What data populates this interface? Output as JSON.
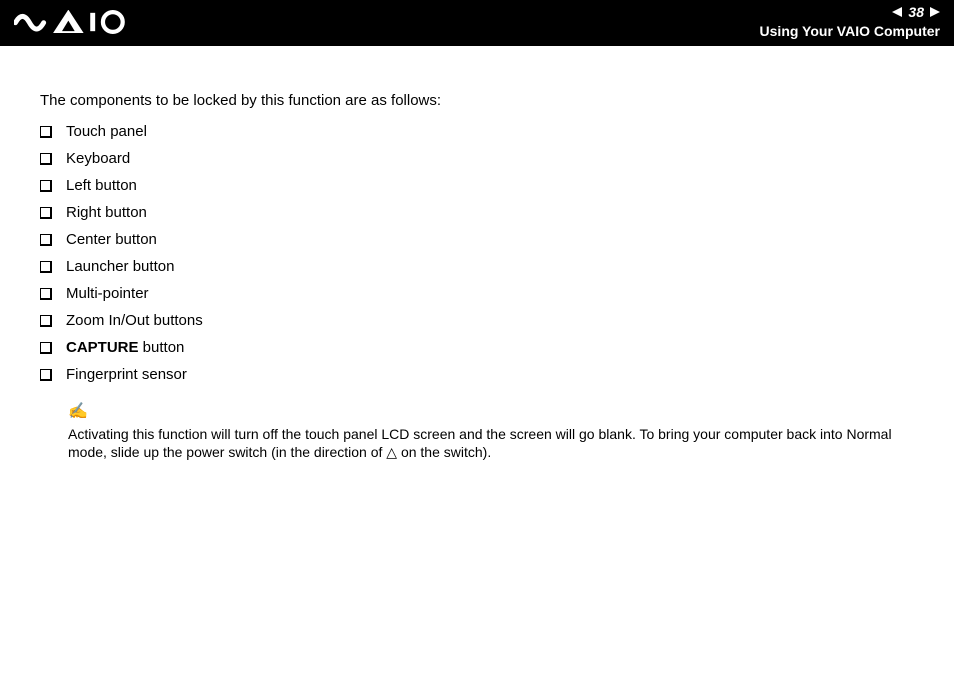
{
  "header": {
    "page_number": "38",
    "section_title": "Using Your VAIO Computer"
  },
  "content": {
    "intro": "The components to be locked by this function are as follows:",
    "components": [
      {
        "label": "Touch panel"
      },
      {
        "label": "Keyboard"
      },
      {
        "label": "Left button"
      },
      {
        "label": "Right button"
      },
      {
        "label": "Center button"
      },
      {
        "label": "Launcher button"
      },
      {
        "label": "Multi-pointer"
      },
      {
        "label": "Zoom In/Out buttons"
      },
      {
        "bold_part": "CAPTURE",
        "rest": " button"
      },
      {
        "label": "Fingerprint sensor"
      }
    ],
    "note_icon": "✍",
    "note_text_1": "Activating this function will turn off the touch panel LCD screen and the screen will go blank. To bring your computer back into Normal mode, slide up the power switch (in the direction of ",
    "note_triangle": "△",
    "note_text_2": " on the switch)."
  }
}
